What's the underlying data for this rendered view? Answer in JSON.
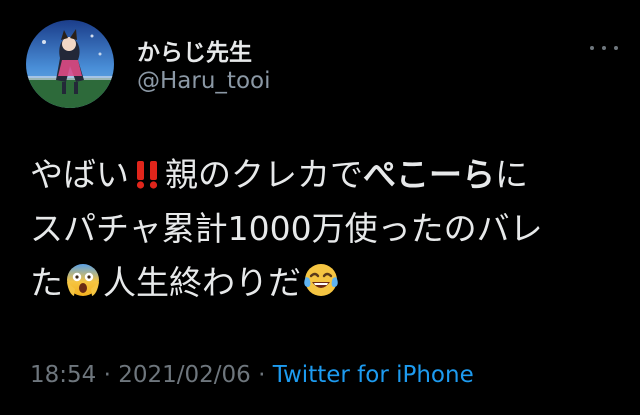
{
  "tweet": {
    "author": {
      "display_name": "からじ先生",
      "handle": "@Haru_tooi"
    },
    "text": {
      "line1": {
        "a": "やばい",
        "emoji1": "double-exclamation-emoji",
        "b": "親のクレカで",
        "c_bold": "ぺこーら",
        "d": "に"
      },
      "line2": "スパチャ累計1000万使ったのバレ",
      "line3": {
        "a": "た",
        "emoji2": "screaming-face-emoji",
        "b": "人生終わりだ",
        "emoji3": "tears-of-joy-emoji"
      }
    },
    "meta": {
      "time": "18:54",
      "separator1": " · ",
      "date": "2021/02/06",
      "separator2": " · ",
      "source": "Twitter for iPhone"
    }
  },
  "colors": {
    "background": "#000000",
    "text": "#e7e9ea",
    "secondary": "#8b98a5",
    "link": "#1d9bf0"
  }
}
